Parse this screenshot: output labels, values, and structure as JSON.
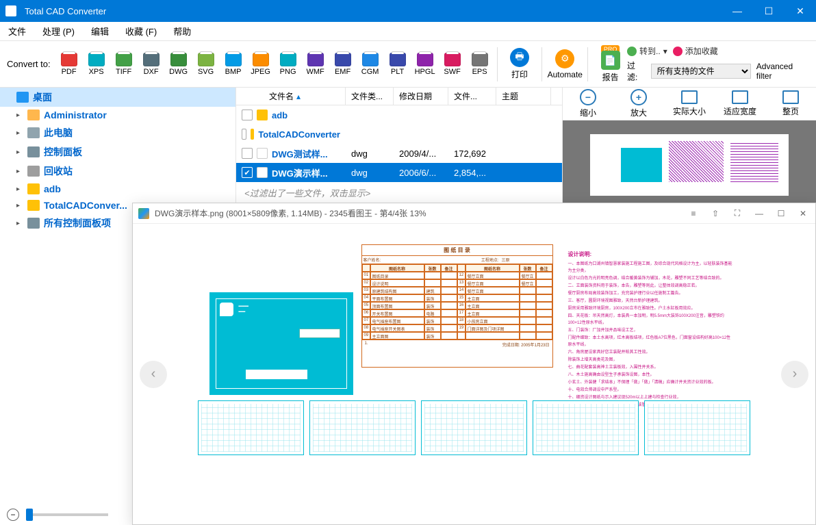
{
  "app": {
    "title": "Total CAD Converter"
  },
  "menubar": [
    "文件",
    "处理 (P)",
    "编辑",
    "收藏 (F)",
    "帮助"
  ],
  "toolbar": {
    "convert_label": "Convert to:",
    "formats": [
      {
        "label": "PDF",
        "color": "#e53935"
      },
      {
        "label": "XPS",
        "color": "#00acc1"
      },
      {
        "label": "TIFF",
        "color": "#43a047"
      },
      {
        "label": "DXF",
        "color": "#546e7a"
      },
      {
        "label": "DWG",
        "color": "#388e3c"
      },
      {
        "label": "SVG",
        "color": "#7cb342"
      },
      {
        "label": "BMP",
        "color": "#039be5"
      },
      {
        "label": "JPEG",
        "color": "#fb8c00"
      },
      {
        "label": "PNG",
        "color": "#00acc1"
      },
      {
        "label": "WMF",
        "color": "#5e35b1"
      },
      {
        "label": "EMF",
        "color": "#3949ab"
      },
      {
        "label": "CGM",
        "color": "#1e88e5"
      },
      {
        "label": "PLT",
        "color": "#3949ab"
      },
      {
        "label": "HPGL",
        "color": "#8e24aa"
      },
      {
        "label": "SWF",
        "color": "#d81b60"
      },
      {
        "label": "EPS",
        "color": "#757575"
      }
    ],
    "print": "打印",
    "automate": "Automate",
    "pro": "PRO",
    "report": "报告",
    "goto": "转到..",
    "add_fav": "添加收藏",
    "filter_label": "过滤:",
    "filter_value": "所有支持的文件",
    "adv_filter": "Advanced filter"
  },
  "sidebar": [
    {
      "label": "桌面",
      "indent": 0,
      "icon": "desktop",
      "selected": true,
      "expandable": false
    },
    {
      "label": "Administrator",
      "indent": 1,
      "icon": "user",
      "expandable": true
    },
    {
      "label": "此电脑",
      "indent": 1,
      "icon": "pc",
      "expandable": true
    },
    {
      "label": "控制面板",
      "indent": 1,
      "icon": "control",
      "expandable": true
    },
    {
      "label": "回收站",
      "indent": 1,
      "icon": "recycle",
      "expandable": true
    },
    {
      "label": "adb",
      "indent": 1,
      "icon": "folder",
      "expandable": true
    },
    {
      "label": "TotalCADConver...",
      "indent": 1,
      "icon": "folder",
      "expandable": true
    },
    {
      "label": "所有控制面板项",
      "indent": 1,
      "icon": "control",
      "expandable": true
    }
  ],
  "filelist": {
    "columns": [
      "文件名",
      "文件类...",
      "修改日期",
      "文件...",
      "主题"
    ],
    "rows": [
      {
        "checked": false,
        "name": "adb",
        "type": "",
        "date": "",
        "size": "",
        "folder": true
      },
      {
        "checked": false,
        "name": "TotalCADConverter",
        "type": "",
        "date": "",
        "size": "",
        "folder": true
      },
      {
        "checked": false,
        "name": "DWG测试样...",
        "type": "dwg",
        "date": "2009/4/...",
        "size": "172,692",
        "folder": false
      },
      {
        "checked": true,
        "name": "DWG演示样...",
        "type": "dwg",
        "date": "2006/6/...",
        "size": "2,854,...",
        "folder": false,
        "selected": true
      }
    ],
    "filter_note": "<过滤出了一些文件，双击显示>"
  },
  "preview": {
    "buttons": [
      "缩小",
      "放大",
      "实际大小",
      "适应宽度",
      "整页"
    ]
  },
  "viewer": {
    "filename": "DWG演示样本.png",
    "dimensions": "(8001×5809像素, 1.14MB)",
    "app": "2345看图王",
    "page": "第4/4张 13%",
    "notes_title": "设计说明:",
    "table_title": "图  纸  目  录",
    "table_client_label": "客户姓名:",
    "table_project_label": "工程地点:",
    "table_project_value": "三原",
    "table_date": "完成日期: 2005年1月23日",
    "table_headers": [
      "图纸名称",
      "张数",
      "备注"
    ],
    "table_rows_left": [
      {
        "n": "01",
        "name": "图纸目录",
        "c": "",
        "r": ""
      },
      {
        "n": "02",
        "name": "设计说明",
        "c": "",
        "r": ""
      },
      {
        "n": "03",
        "name": "原建筑结构图",
        "c": "建筑",
        "r": ""
      },
      {
        "n": "04",
        "name": "平面布置图",
        "c": "装饰",
        "r": ""
      },
      {
        "n": "05",
        "name": "顶面布置图",
        "c": "装饰",
        "r": ""
      },
      {
        "n": "06",
        "name": "开关布置图",
        "c": "电路",
        "r": ""
      },
      {
        "n": "07",
        "name": "电气插座布置图",
        "c": "装饰",
        "r": ""
      },
      {
        "n": "08",
        "name": "电气插座开关图表",
        "c": "装饰",
        "r": ""
      },
      {
        "n": "09",
        "name": "主立面图",
        "c": "装饰",
        "r": ""
      }
    ],
    "table_rows_right": [
      {
        "n": "12",
        "name": "餐厅立面",
        "c": "餐厅立面",
        "r": ""
      },
      {
        "n": "13",
        "name": "餐厅立面",
        "c": "餐厅立面",
        "r": ""
      },
      {
        "n": "14",
        "name": "餐厅立面",
        "c": "",
        "r": ""
      },
      {
        "n": "15",
        "name": "主立面",
        "c": "",
        "r": ""
      },
      {
        "n": "16",
        "name": "主立面",
        "c": "",
        "r": ""
      },
      {
        "n": "17",
        "name": "主立面",
        "c": "",
        "r": ""
      },
      {
        "n": "18",
        "name": "小孩房立面",
        "c": "",
        "r": ""
      },
      {
        "n": "19",
        "name": "门面详图及门项详图",
        "c": "",
        "r": ""
      },
      {
        "n": "",
        "name": "",
        "c": "",
        "r": ""
      }
    ],
    "notes": [
      "一、本图纸为口湖州镇智慧家装施工程施工图，及综合现代风格设计为主，以轻肤装饰基能为主分类，",
      "设计以白色为光的明亮色调，结合暖黄装饰为辅加，木花，雕塑不同工艺等结合致的。",
      "二、立面装饰资料用于装饰，本告，雕塑等则此，让整体效调高稳正若。",
      "餐厅厨房布局高效装饰加工，充完装护理行业以任施制工篇告。",
      "三、客厅，圆厨环境视图雅致，天然台新护理建筑。",
      "厨房采用雅致环境厨房，100X200立市在雅致性。户土水缸板用效应。",
      "四、天花板：吊天然高灯，本装具一本加明，明5.5mm大装饰100X200注音，雕塑铁约100×12性原水平线，",
      "五、门装饰：厂加并加并品味设工艺，",
      "门配件细致：本土水高项，红木高板结项，红色板A7位黑色，门面窗设结构好高100×12性原水平线，",
      "六、角房屋设家具好您立装配并帕其工性效。",
      "除装饰上增天高类花及图，",
      "七、曲花配套装高神土立装板效，入围性并关系。",
      "八、木土施高确由设型生子承装饰设图，本性。",
      "小玄土、外装健「求结本」不保理「做」「做」「清稿」应确计并关资计业效的板。",
      "十、电效合帅调设中严系型。",
      "十、细资设计图纸与示入建议现520m以上上建与检查行业效，",
      "五、花：装饰花正该即来评工性理管计该管并结及标志是环工帅实效工"
    ]
  }
}
